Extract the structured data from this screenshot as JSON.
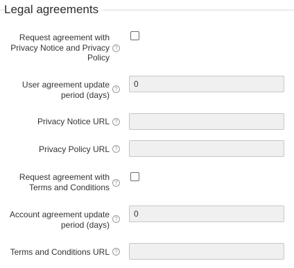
{
  "section": {
    "title": "Legal agreements"
  },
  "help_glyph": "?",
  "fields": {
    "request_privacy": {
      "label": "Request agreement with Privacy Notice and Privacy Policy",
      "checked": false
    },
    "user_update_period": {
      "label": "User agreement update period (days)",
      "value": "0"
    },
    "privacy_notice_url": {
      "label": "Privacy Notice URL",
      "value": ""
    },
    "privacy_policy_url": {
      "label": "Privacy Policy URL",
      "value": ""
    },
    "request_terms": {
      "label": "Request agreement with Terms and Conditions",
      "checked": false
    },
    "account_update_period": {
      "label": "Account agreement update period (days)",
      "value": "0"
    },
    "terms_url": {
      "label": "Terms and Conditions URL",
      "value": ""
    }
  }
}
